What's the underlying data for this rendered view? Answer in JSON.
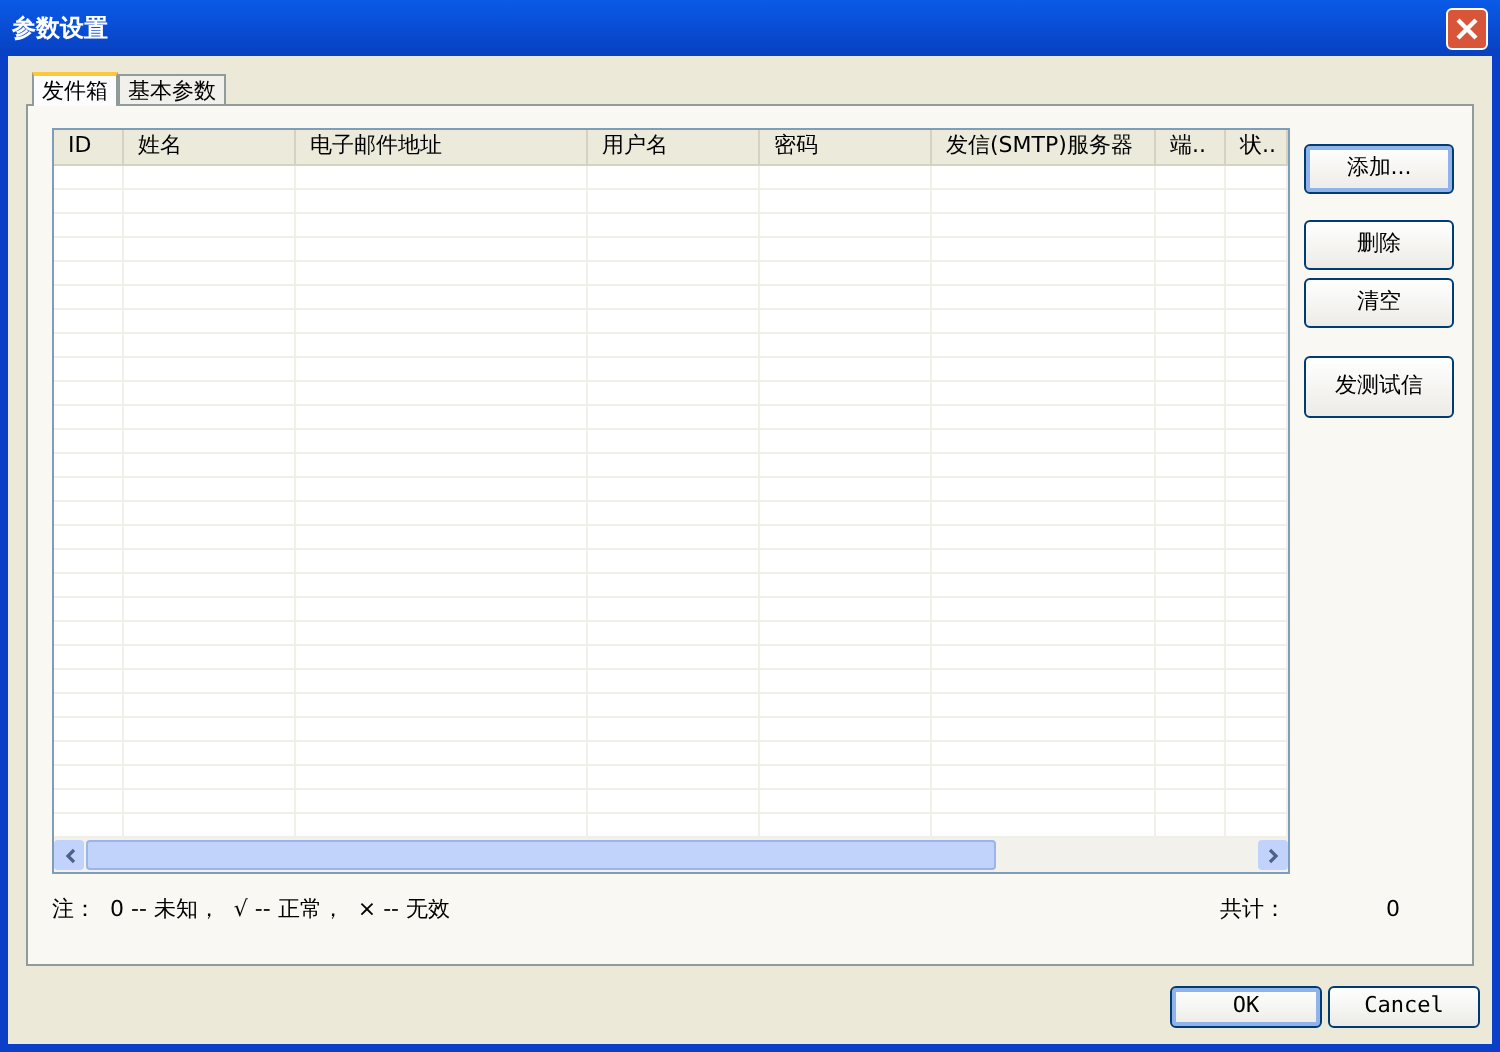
{
  "window": {
    "title": "参数设置"
  },
  "tabs": [
    {
      "label": "发件箱",
      "selected": true
    },
    {
      "label": "基本参数",
      "selected": false
    }
  ],
  "table": {
    "columns": [
      "ID",
      "姓名",
      "电子邮件地址",
      "用户名",
      "密码",
      "发信(SMTP)服务器",
      "端..",
      "状.."
    ]
  },
  "side_buttons": [
    "添加...",
    "删除",
    "清空",
    "发测试信"
  ],
  "note": "注：  0 -- 未知，  √ -- 正常，  × -- 无效",
  "total": {
    "label": "共计：",
    "value": "0"
  },
  "buttons": [
    "OK",
    "Cancel"
  ]
}
